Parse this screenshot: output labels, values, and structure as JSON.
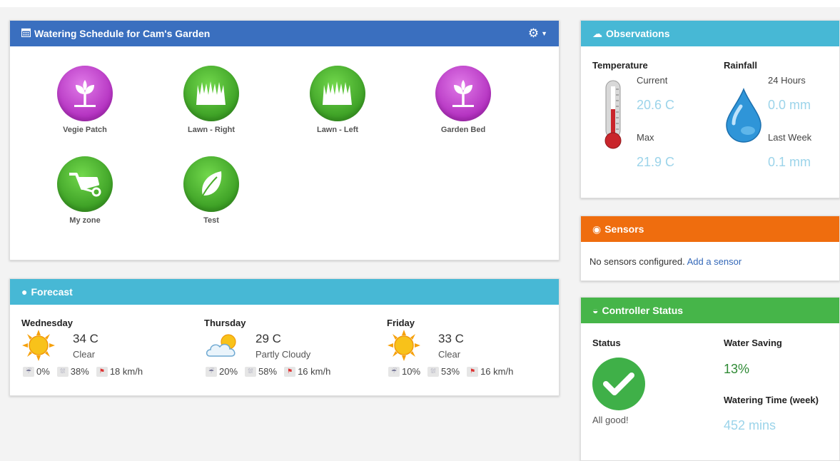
{
  "schedule": {
    "title": "Watering Schedule for Cam's Garden",
    "zones": [
      {
        "label": "Vegie Patch",
        "icon": "plant-icon",
        "color": "#c041cd"
      },
      {
        "label": "Lawn - Right",
        "icon": "grass-icon",
        "color": "#4aad2a"
      },
      {
        "label": "Lawn - Left",
        "icon": "grass-icon",
        "color": "#4aad2a"
      },
      {
        "label": "Garden Bed",
        "icon": "plant-icon",
        "color": "#c041cd"
      },
      {
        "label": "My zone",
        "icon": "wheelbarrow-icon",
        "color": "#4aad2a"
      },
      {
        "label": "Test",
        "icon": "leaf-icon",
        "color": "#4aad2a"
      }
    ]
  },
  "forecast": {
    "title": "Forecast",
    "days": [
      {
        "name": "Wednesday",
        "temp": "34 C",
        "condition": "Clear",
        "icon": "sun-icon",
        "rain": "0%",
        "humidity": "38%",
        "wind": "18 km/h"
      },
      {
        "name": "Thursday",
        "temp": "29 C",
        "condition": "Partly Cloudy",
        "icon": "partly-cloudy-icon",
        "rain": "20%",
        "humidity": "58%",
        "wind": "16 km/h"
      },
      {
        "name": "Friday",
        "temp": "33 C",
        "condition": "Clear",
        "icon": "sun-icon",
        "rain": "10%",
        "humidity": "53%",
        "wind": "16 km/h"
      }
    ]
  },
  "observations": {
    "title": "Observations",
    "temperature": {
      "heading": "Temperature",
      "current_label": "Current",
      "current": "20.6 C",
      "max_label": "Max",
      "max": "21.9 C"
    },
    "rainfall": {
      "heading": "Rainfall",
      "day_label": "24 Hours",
      "day": "0.0 mm",
      "week_label": "Last Week",
      "week": "0.1 mm"
    }
  },
  "sensors": {
    "title": "Sensors",
    "message": "No sensors configured.",
    "link": "Add a sensor"
  },
  "controller": {
    "title": "Controller Status",
    "status_heading": "Status",
    "status_text": "All good!",
    "saving_heading": "Water Saving",
    "saving_value": "13%",
    "time_heading": "Watering Time (week)",
    "time_value": "452 mins"
  },
  "colors": {
    "header_blue": "#3a6fbf",
    "header_cyan": "#47b8d5",
    "header_orange": "#ef6d0e",
    "header_green": "#46b549",
    "value_light_blue": "#9cd4ea",
    "value_green": "#2f8a35"
  }
}
